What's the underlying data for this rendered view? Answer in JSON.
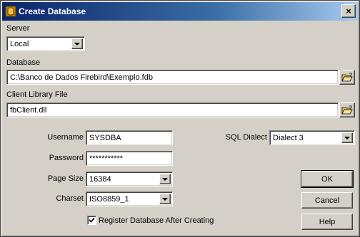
{
  "window": {
    "title": "Create Database",
    "close_label": "×"
  },
  "server": {
    "label": "Server",
    "value": "Local"
  },
  "database": {
    "label": "Database",
    "value": "C:\\Banco de Dados Firebird\\Exemplo.fdb"
  },
  "client_library": {
    "label": "Client Library File",
    "value": "fbClient.dll"
  },
  "username": {
    "label": "Username",
    "value": "SYSDBA"
  },
  "password": {
    "label": "Password",
    "value": "***********"
  },
  "page_size": {
    "label": "Page Size",
    "value": "16384"
  },
  "charset": {
    "label": "Charset",
    "value": "ISO8859_1"
  },
  "sql_dialect": {
    "label": "SQL Dialect",
    "value": "Dialect 3"
  },
  "register_checkbox": {
    "label": "Register Database After Creating",
    "checked": true
  },
  "buttons": {
    "ok": "OK",
    "cancel": "Cancel",
    "help": "Help"
  }
}
